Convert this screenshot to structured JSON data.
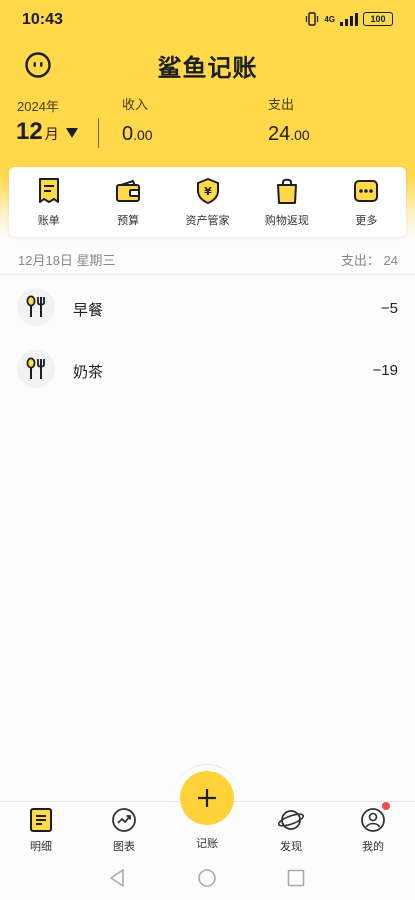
{
  "status": {
    "time": "10:43",
    "network": "4G",
    "battery": "100"
  },
  "header": {
    "title": "鲨鱼记账",
    "year": "2024年",
    "month_num": "12",
    "month_unit": "月",
    "income_label": "收入",
    "income_int": "0",
    "income_dec": ".00",
    "expense_label": "支出",
    "expense_int": "24",
    "expense_dec": ".00"
  },
  "quick_actions": [
    {
      "label": "账单",
      "icon": "bill-icon"
    },
    {
      "label": "预算",
      "icon": "budget-wallet-icon"
    },
    {
      "label": "资产管家",
      "icon": "asset-shield-icon"
    },
    {
      "label": "购物返现",
      "icon": "shopping-bag-icon"
    },
    {
      "label": "更多",
      "icon": "more-icon"
    }
  ],
  "day_group": {
    "date": "12月18日 星期三",
    "summary": "支出： 24"
  },
  "records": [
    {
      "name": "早餐",
      "amount": "−5",
      "icon": "fork-spoon-icon"
    },
    {
      "name": "奶茶",
      "amount": "−19",
      "icon": "fork-spoon-icon"
    }
  ],
  "tabs": [
    {
      "label": "明细",
      "icon": "list-detail-icon"
    },
    {
      "label": "图表",
      "icon": "chart-icon"
    },
    {
      "label": "记账",
      "icon": "plus-icon"
    },
    {
      "label": "发现",
      "icon": "planet-icon"
    },
    {
      "label": "我的",
      "icon": "user-icon"
    }
  ],
  "colors": {
    "brand_yellow": "#ffd94a",
    "fab_yellow": "#ffd23a",
    "badge_red": "#f04a4a"
  }
}
